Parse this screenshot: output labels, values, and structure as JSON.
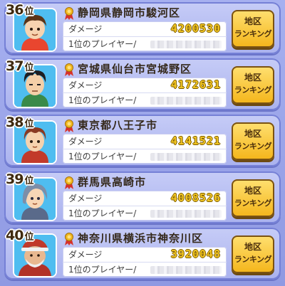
{
  "leaderboard": {
    "damage_label": "ダメージ",
    "player_label": "1位のプレイヤー/",
    "button_line1": "地区",
    "button_line2": "ランキング",
    "rank_suffix": "位",
    "entries": [
      {
        "rank": "36",
        "region": "静岡県静岡市駿河区",
        "damage": "4200530"
      },
      {
        "rank": "37",
        "region": "宮城県仙台市宮城野区",
        "damage": "4172631"
      },
      {
        "rank": "38",
        "region": "東京都八王子市",
        "damage": "4141521"
      },
      {
        "rank": "39",
        "region": "群馬県高崎市",
        "damage": "4008526"
      },
      {
        "rank": "40",
        "region": "神奈川県横浜市神奈川区",
        "damage": "3920048"
      }
    ]
  }
}
